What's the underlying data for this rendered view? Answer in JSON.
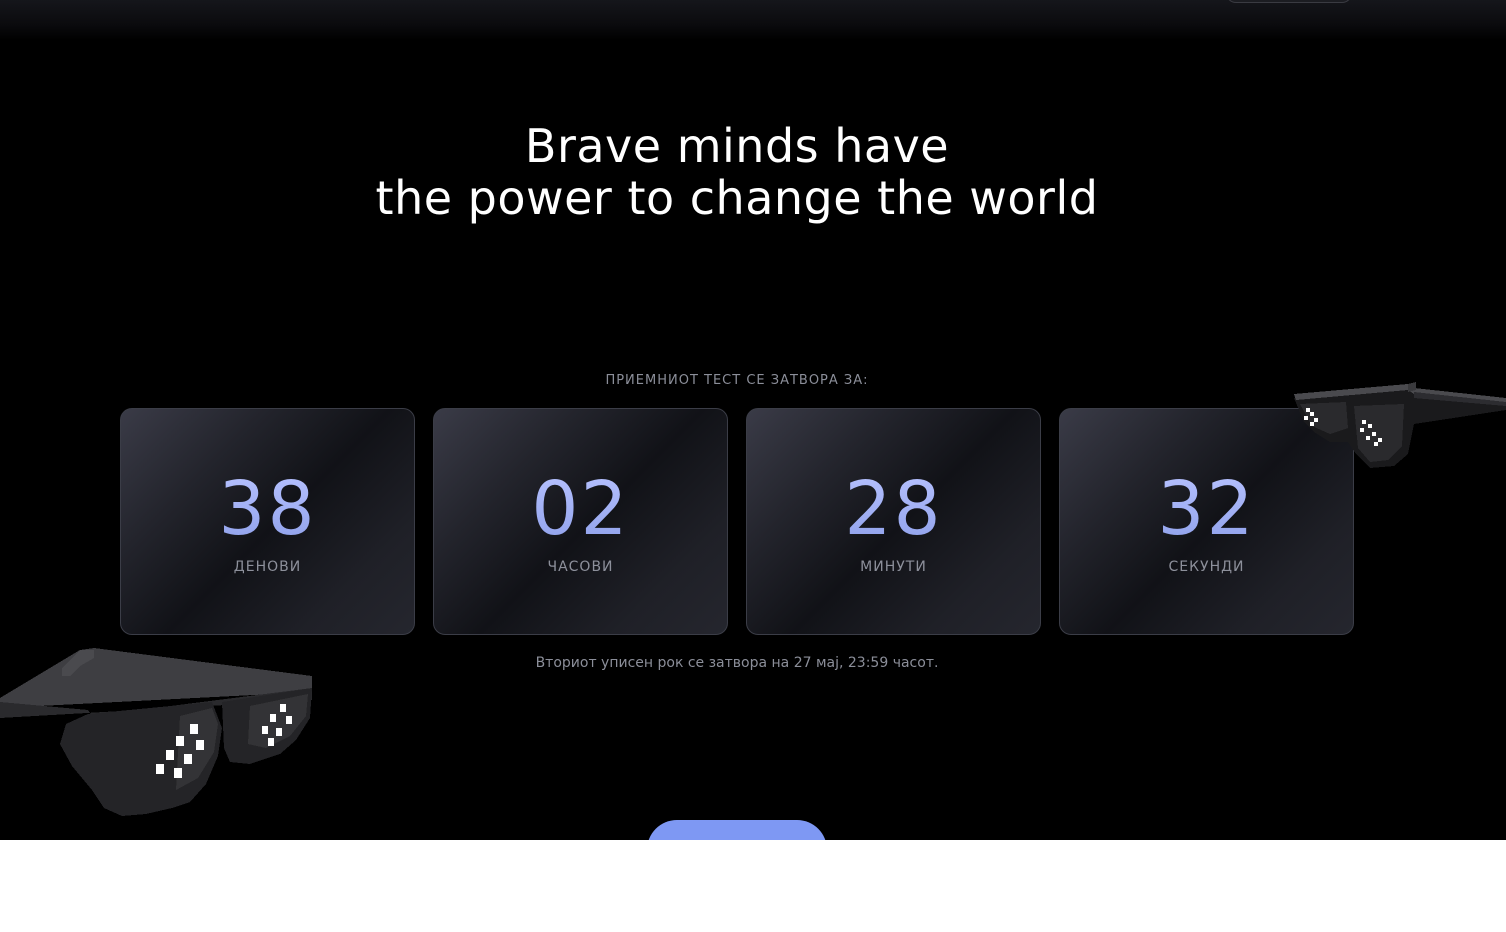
{
  "hero": {
    "title_line1": "Brave minds have",
    "title_line2": "the power to change the world"
  },
  "countdown": {
    "label": "ПРИЕМНИОТ ТЕСТ СЕ ЗАТВОРА ЗА:",
    "items": [
      {
        "value": "38",
        "unit": "ДЕНОВИ"
      },
      {
        "value": "02",
        "unit": "ЧАСОВИ"
      },
      {
        "value": "28",
        "unit": "МИНУТИ"
      },
      {
        "value": "32",
        "unit": "СЕКУНДИ"
      }
    ],
    "deadline_text": "Вториот уписен рок се затвора на 27 мај, 23:59 часот."
  },
  "cta": {
    "label": ""
  },
  "decorations": {
    "left_icon": "pixel-sunglasses-icon",
    "right_icon": "pixel-sunglasses-icon"
  },
  "colors": {
    "background": "#000000",
    "accent": "#7e98f3",
    "number": "#9aaaf2",
    "muted_text": "#8b8e99"
  }
}
